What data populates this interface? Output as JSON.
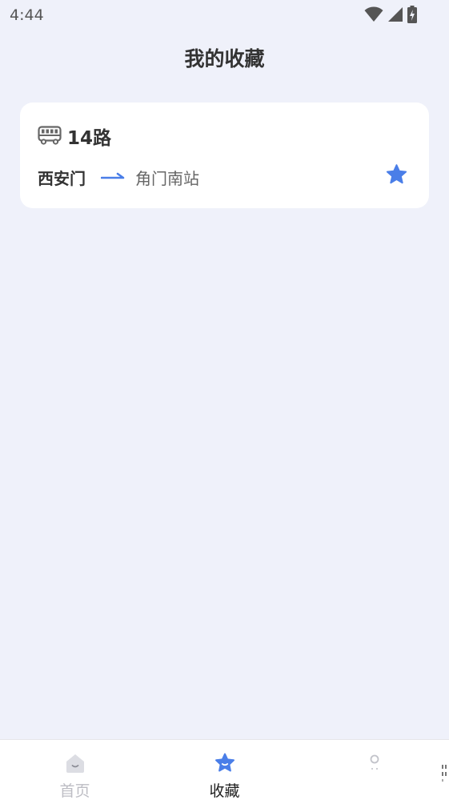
{
  "status_bar": {
    "time": "4:44",
    "icons": [
      "wifi-icon",
      "signal-icon",
      "battery-charging-icon"
    ]
  },
  "header": {
    "title": "我的收藏"
  },
  "favorites": [
    {
      "route_name": "14路",
      "icon": "bus-icon",
      "start_station": "西安门",
      "end_station": "角门南站",
      "favorited": true
    }
  ],
  "bottom_nav": {
    "items": [
      {
        "label": "首页",
        "icon": "home-icon",
        "active": false
      },
      {
        "label": "收藏",
        "icon": "star-icon",
        "active": true
      },
      {
        "label": "",
        "icon": "profile-icon",
        "active": false
      }
    ]
  },
  "colors": {
    "background": "#eff1fa",
    "accent": "#4a7ee8",
    "card": "#ffffff",
    "text_primary": "#333333",
    "text_secondary": "#666666",
    "nav_inactive": "#bdbdc4"
  }
}
